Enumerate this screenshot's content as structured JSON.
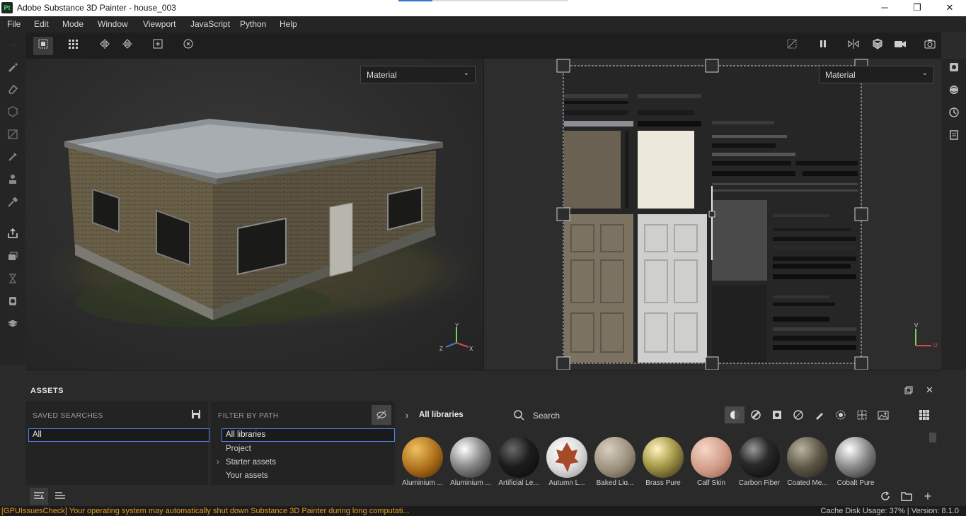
{
  "window": {
    "app_icon": "Pt",
    "title": "Adobe Substance 3D Painter - house_003",
    "minimize": "─",
    "maximize": "❐",
    "close": "✕"
  },
  "menu": [
    "File",
    "Edit",
    "Mode",
    "Window",
    "Viewport",
    "JavaScript",
    "Python",
    "Help"
  ],
  "viewport3d": {
    "mode_label": "Material",
    "axis_x": "X",
    "axis_y": "Y",
    "axis_z": "Z"
  },
  "viewport2d": {
    "mode_label": "Material",
    "axis_u": "U",
    "axis_v": "V"
  },
  "assets": {
    "title": "ASSETS",
    "saved_searches_title": "SAVED SEARCHES",
    "saved_search_value": "All",
    "filter_by_path_title": "FILTER BY PATH",
    "paths": [
      "All libraries",
      "Project",
      "Starter assets",
      "Your assets"
    ],
    "breadcrumb": "All libraries",
    "search_placeholder": "Search",
    "materials": [
      {
        "label": "Aluminium ..."
      },
      {
        "label": "Aluminium ..."
      },
      {
        "label": "Artificial Le..."
      },
      {
        "label": "Autumn L..."
      },
      {
        "label": "Baked Lig..."
      },
      {
        "label": "Brass Pure"
      },
      {
        "label": "Calf Skin"
      },
      {
        "label": "Carbon Fiber"
      },
      {
        "label": "Coated Me..."
      },
      {
        "label": "Cobalt Pure"
      }
    ]
  },
  "status": {
    "warning": "[GPUIssuesCheck] Your operating system may automatically shut down Substance 3D Painter during long computati...",
    "right": "Cache Disk Usage:   37% | Version: 8.1.0"
  },
  "colors": {
    "accent": "#4a8ae6",
    "warning": "#e89a1f"
  }
}
